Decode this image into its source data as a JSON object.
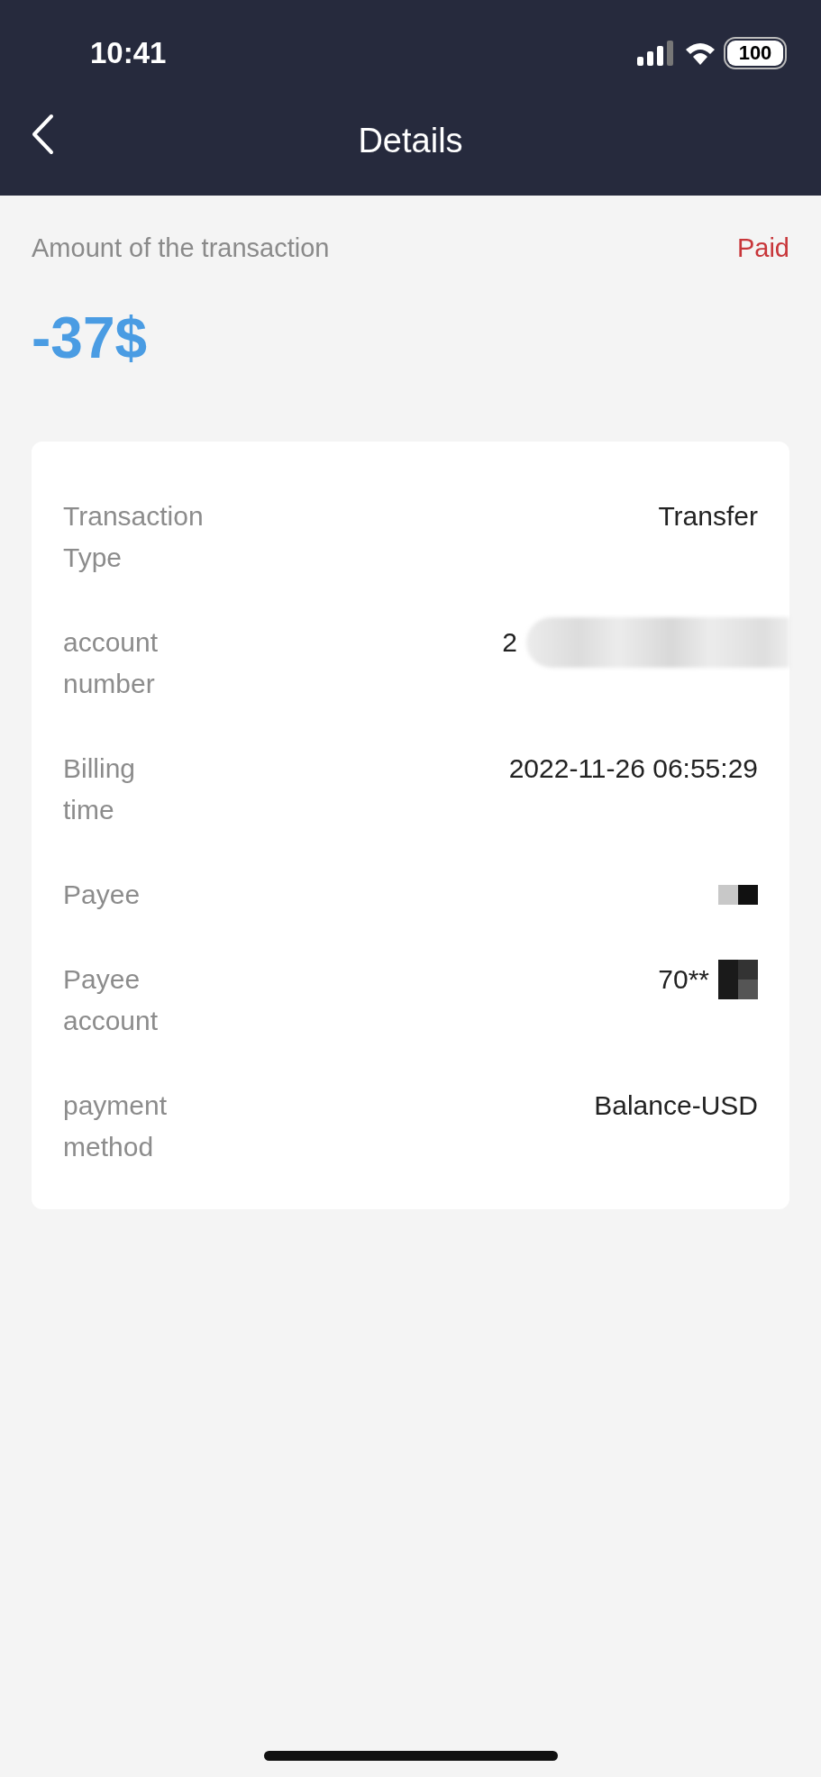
{
  "status_bar": {
    "time": "10:41",
    "battery": "100"
  },
  "header": {
    "title": "Details"
  },
  "summary": {
    "label": "Amount of the transaction",
    "status": "Paid",
    "amount": "-37$"
  },
  "details": [
    {
      "kind": "text",
      "label": "Transaction\nType",
      "value": "Transfer"
    },
    {
      "kind": "blurred",
      "label": "account\nnumber",
      "value": "2"
    },
    {
      "kind": "text",
      "label": "Billing\ntime",
      "value": "2022-11-26 06:55:29"
    },
    {
      "kind": "mosaic",
      "label": "Payee"
    },
    {
      "kind": "blocks",
      "label": "Payee\naccount",
      "value": "70**"
    },
    {
      "kind": "text",
      "label": "payment\nmethod",
      "value": "Balance-USD"
    }
  ]
}
